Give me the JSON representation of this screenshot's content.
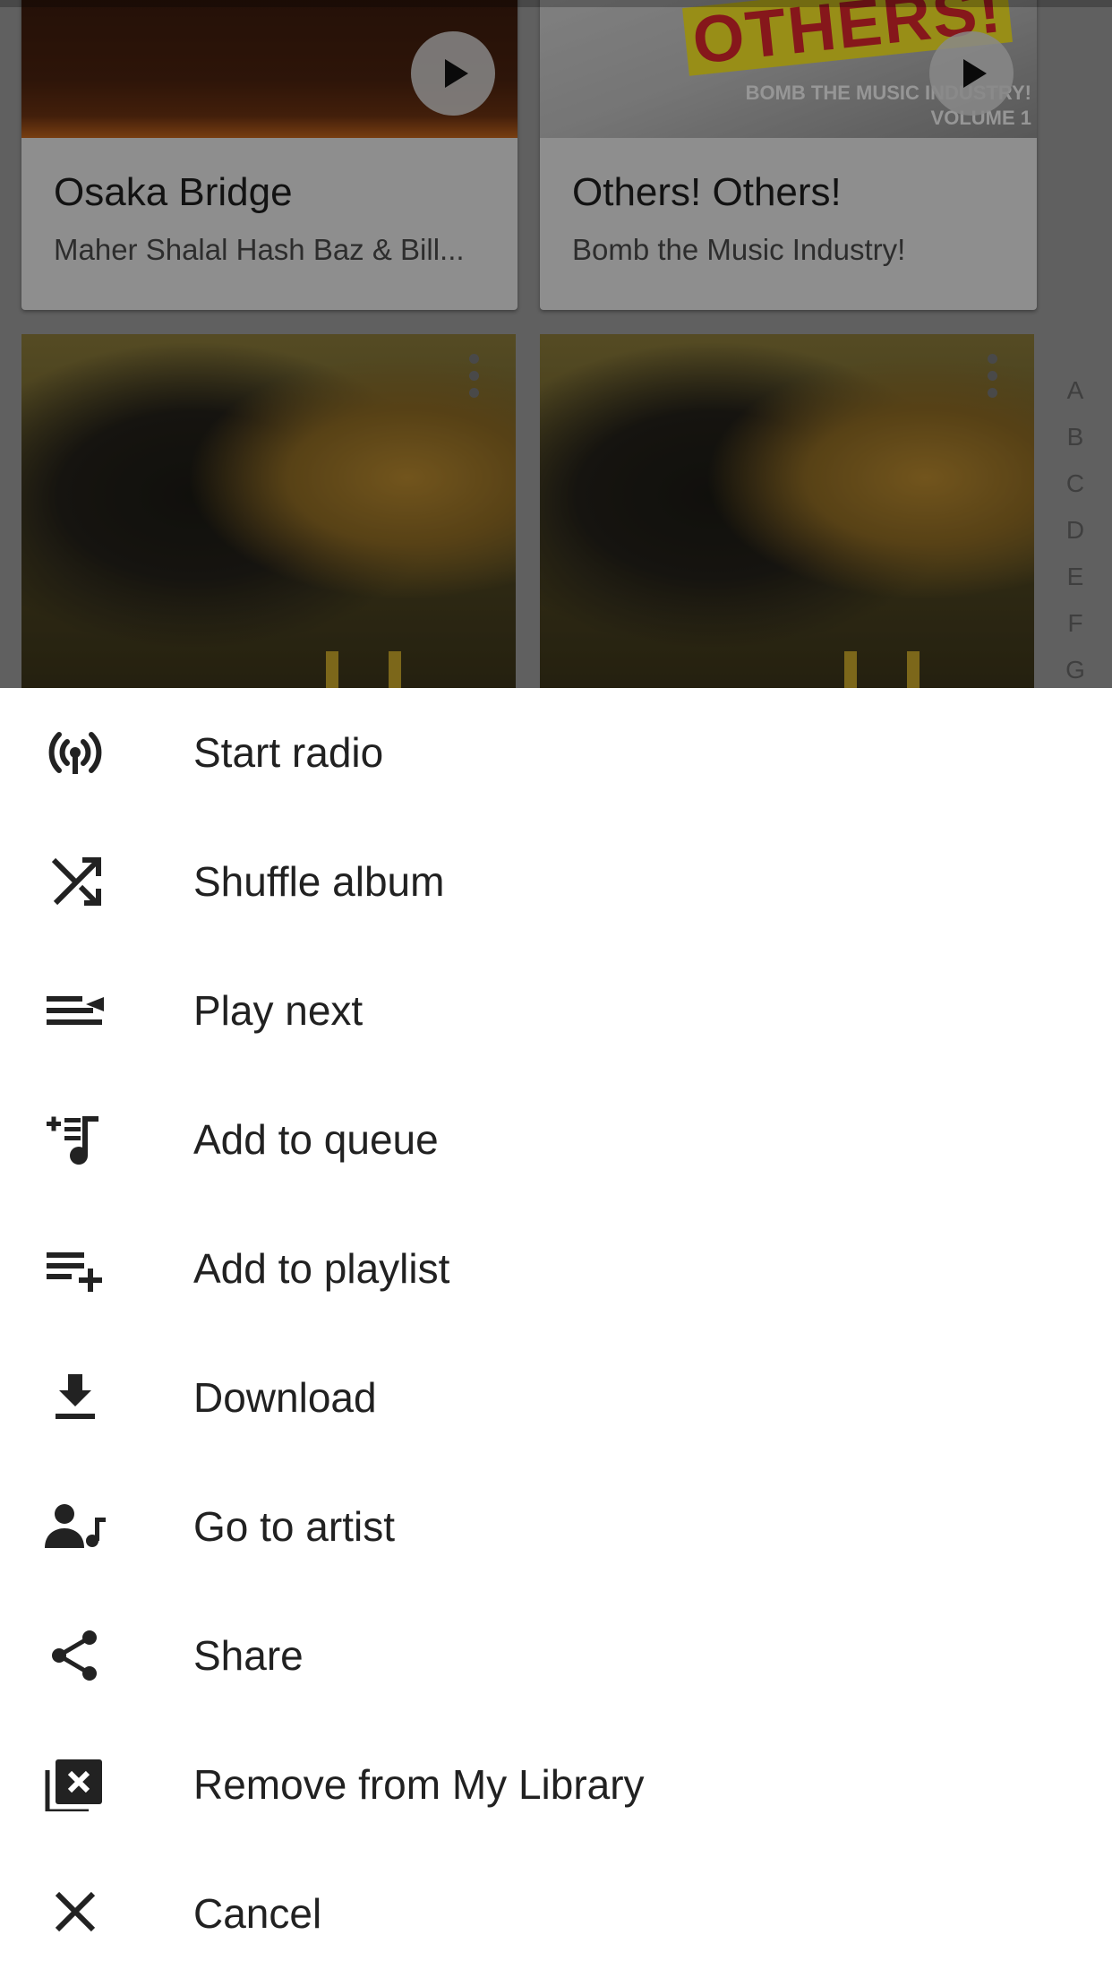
{
  "background": {
    "cards": [
      {
        "title": "Osaka Bridge",
        "subtitle": "Maher Shalal Hash Baz & Bill..."
      },
      {
        "title": "Others! Others!",
        "subtitle": "Bomb the Music Industry!",
        "art_text": {
          "title": "OTHERS!",
          "line1": "BOMB THE MUSIC INDUSTRY!",
          "line2": "VOLUME 1"
        }
      }
    ],
    "alphabet_index": [
      "A",
      "B",
      "C",
      "D",
      "E",
      "F",
      "G"
    ]
  },
  "sheet": {
    "items": [
      {
        "label": "Start radio",
        "icon": "radio-icon"
      },
      {
        "label": "Shuffle album",
        "icon": "shuffle-icon"
      },
      {
        "label": "Play next",
        "icon": "play-next-icon"
      },
      {
        "label": "Add to queue",
        "icon": "add-to-queue-icon"
      },
      {
        "label": "Add to playlist",
        "icon": "playlist-add-icon"
      },
      {
        "label": "Download",
        "icon": "download-icon"
      },
      {
        "label": "Go to artist",
        "icon": "artist-icon"
      },
      {
        "label": "Share",
        "icon": "share-icon"
      },
      {
        "label": "Remove from My Library",
        "icon": "remove-library-icon"
      },
      {
        "label": "Cancel",
        "icon": "close-icon"
      }
    ]
  }
}
